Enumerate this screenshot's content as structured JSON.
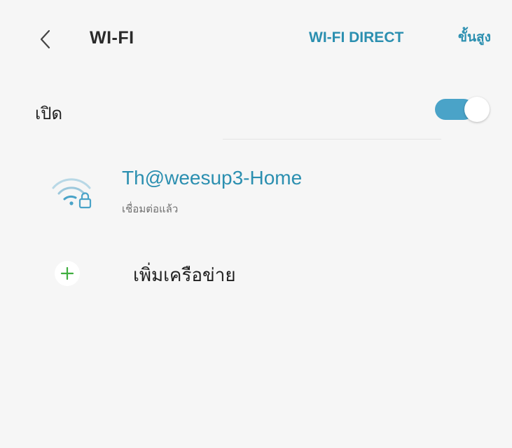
{
  "header": {
    "title": "WI-FI",
    "wifi_direct_label": "WI-FI DIRECT",
    "advanced_label": "ขั้นสูง"
  },
  "toggle": {
    "label": "เปิด",
    "state": "on",
    "track_color": "#4aa3c8"
  },
  "networks": [
    {
      "name": "Th@weesup3-Home",
      "status": "เชื่อมต่อแล้ว",
      "icon": "wifi-locked-icon",
      "secured": true
    }
  ],
  "add_network": {
    "label": "เพิ่มเครือข่าย",
    "icon": "plus-icon"
  },
  "colors": {
    "accent": "#2b8fb0",
    "switch_on": "#4aa3c8",
    "plus_green": "#3fae3f",
    "background": "#f6f6f6",
    "primary_text": "#1f1f1f",
    "secondary_text": "#707070"
  }
}
